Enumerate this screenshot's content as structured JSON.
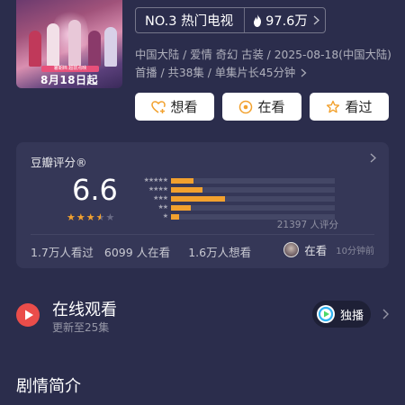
{
  "poster": {
    "badge_text": "暑期档 超前点映",
    "date_text": "8月18日起"
  },
  "rank": {
    "label": "NO.3 热门电视",
    "heat": "97.6万"
  },
  "meta": {
    "info": "中国大陆 / 爱情 奇幻 古装 / 2025-08-18(中国大陆) 首播 / 共38集 / 单集片长45分钟"
  },
  "actions": {
    "want": "想看",
    "watching": "在看",
    "watched": "看过"
  },
  "rating": {
    "title": "豆瓣评分®",
    "score": "6.6",
    "stars": 3.5,
    "distribution_percent": [
      14,
      19,
      33,
      12,
      5
    ],
    "star_rows": [
      "★★★★★",
      "★★★★",
      "★★★",
      "★★",
      "★"
    ],
    "votes": "21397 人评分",
    "stat_watched": "1.7万人看过",
    "stat_watching": "6099 人在看",
    "stat_want": "1.6万人想看",
    "friend_action": "在看",
    "friend_time": "10分钟前",
    "star_color": "#f2a12e",
    "bar_color": "#f2a12e"
  },
  "online": {
    "title": "在线观看",
    "subtitle": "更新至25集",
    "exclusive": "独播",
    "accent": "#ea4d4a"
  },
  "synopsis": {
    "title": "剧情简介"
  }
}
